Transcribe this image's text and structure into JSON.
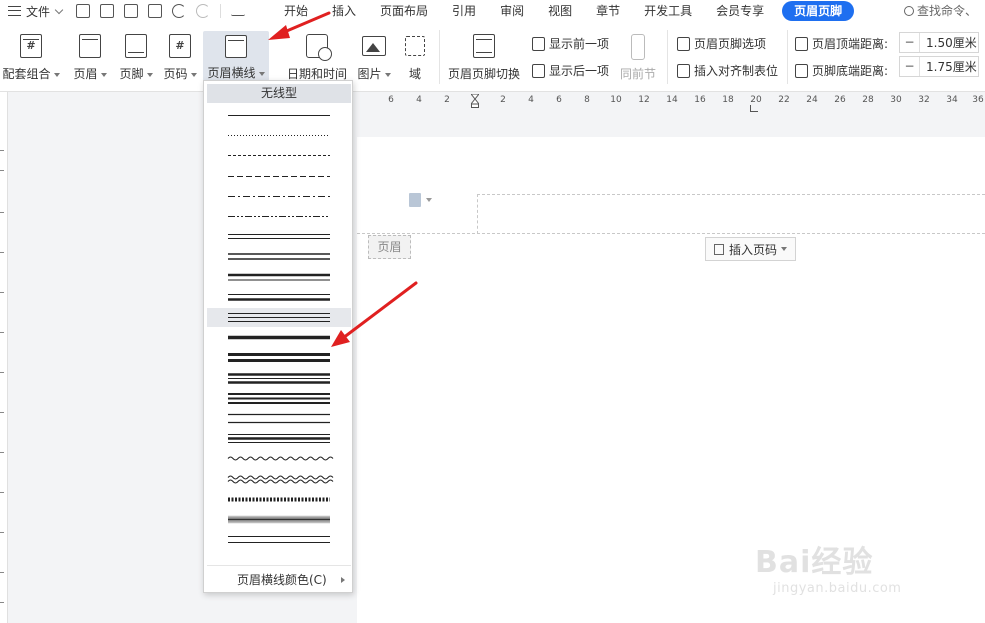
{
  "menu": {
    "file_label": "文件",
    "tabs": [
      "开始",
      "插入",
      "页面布局",
      "引用",
      "审阅",
      "视图",
      "章节",
      "开发工具",
      "会员专享"
    ],
    "active_tab": "页眉页脚",
    "search_placeholder": "查找命令、"
  },
  "ribbon": {
    "buttons": {
      "combo": "配套组合",
      "header": "页眉",
      "footer": "页脚",
      "page_number": "页码",
      "header_line": "页眉横线",
      "datetime": "日期和时间",
      "picture": "图片",
      "field": "域",
      "switch": "页眉页脚切换",
      "same_prev": "同前节"
    },
    "small": {
      "show_prev": "显示前一项",
      "show_next": "显示后一项",
      "options": "页眉页脚选项",
      "align_tab": "插入对齐制表位",
      "top_dist_label": "页眉顶端距离:",
      "bottom_dist_label": "页脚底端距离:"
    },
    "top_distance": "1.50厘米",
    "bottom_distance": "1.75厘米"
  },
  "ruler": {
    "labels": [
      "6",
      "4",
      "2",
      "2",
      "4",
      "6",
      "8",
      "10",
      "12",
      "14",
      "16",
      "18",
      "20",
      "22",
      "24",
      "26",
      "28",
      "30",
      "32",
      "34",
      "36"
    ]
  },
  "document": {
    "header_tag": "页眉",
    "insert_page_number": "插入页码"
  },
  "dropdown": {
    "no_line": "无线型",
    "line_color": "页眉横线颜色(C)",
    "line_styles": [
      "solid",
      "dotted",
      "dashed-fine",
      "dashed",
      "dash-dot",
      "dash-dot-dot",
      "thin-double",
      "double",
      "thick-thin",
      "thin-thick",
      "triple",
      "thick",
      "thick-double",
      "thick-thin-thick",
      "triple-thick",
      "double-spaced",
      "thin-thick-thin",
      "wave",
      "double-wave",
      "hatched",
      "gradient",
      "thin-thin"
    ],
    "highlighted": "triple"
  },
  "watermark": {
    "text": "Bai经验",
    "url": "jingyan.baidu.com"
  },
  "colors": {
    "accent": "#1e6ff0",
    "annotation": "#e02020"
  }
}
